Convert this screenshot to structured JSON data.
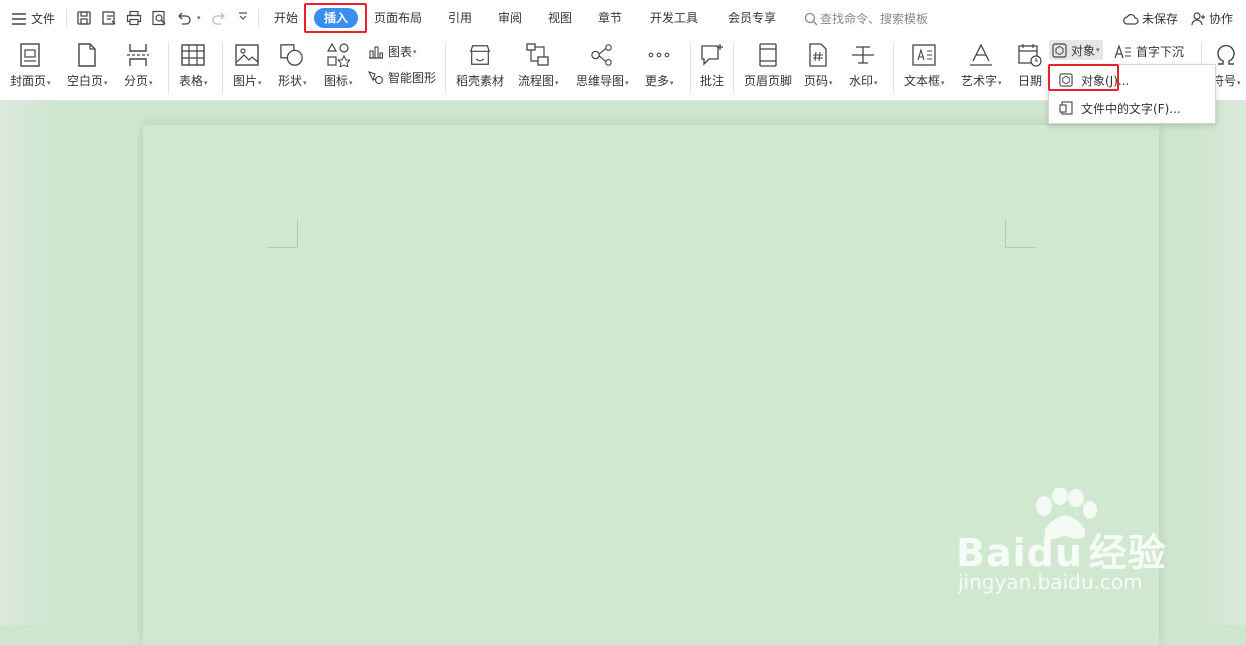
{
  "topbar": {
    "menu_label": "文件",
    "tabs": [
      {
        "label": "开始"
      },
      {
        "label": "插入"
      },
      {
        "label": "页面布局"
      },
      {
        "label": "引用"
      },
      {
        "label": "审阅"
      },
      {
        "label": "视图"
      },
      {
        "label": "章节"
      },
      {
        "label": "开发工具"
      },
      {
        "label": "会员专享"
      }
    ],
    "search_placeholder": "查找命令、搜索模板",
    "save_status": "未保存",
    "collab_label": "协作"
  },
  "ribbon": {
    "cover": "封面页",
    "blank": "空白页",
    "pagebreak": "分页",
    "table": "表格",
    "picture": "图片",
    "shape": "形状",
    "icon": "图标",
    "chart": "图表",
    "smartart": "智能图形",
    "material": "稻壳素材",
    "flowchart": "流程图",
    "mindmap": "思维导图",
    "more": "更多",
    "comment": "批注",
    "header_footer": "页眉页脚",
    "page_number": "页码",
    "watermark": "水印",
    "textbox": "文本框",
    "wordart": "艺术字",
    "date": "日期",
    "object": "对象",
    "dropcap": "首字下沉",
    "symbol": "符号"
  },
  "dropdown": {
    "items": [
      {
        "label": "对象(J)..."
      },
      {
        "label": "文件中的文字(F)..."
      }
    ]
  },
  "watermark": {
    "brand_left": "Bai",
    "brand_mid": "du",
    "brand_right": "经验",
    "url": "jingyan.baidu.com"
  },
  "colors": {
    "accent": "#3a8ef0",
    "highlight": "#e8202a",
    "document_bg": "#cde6cd"
  }
}
